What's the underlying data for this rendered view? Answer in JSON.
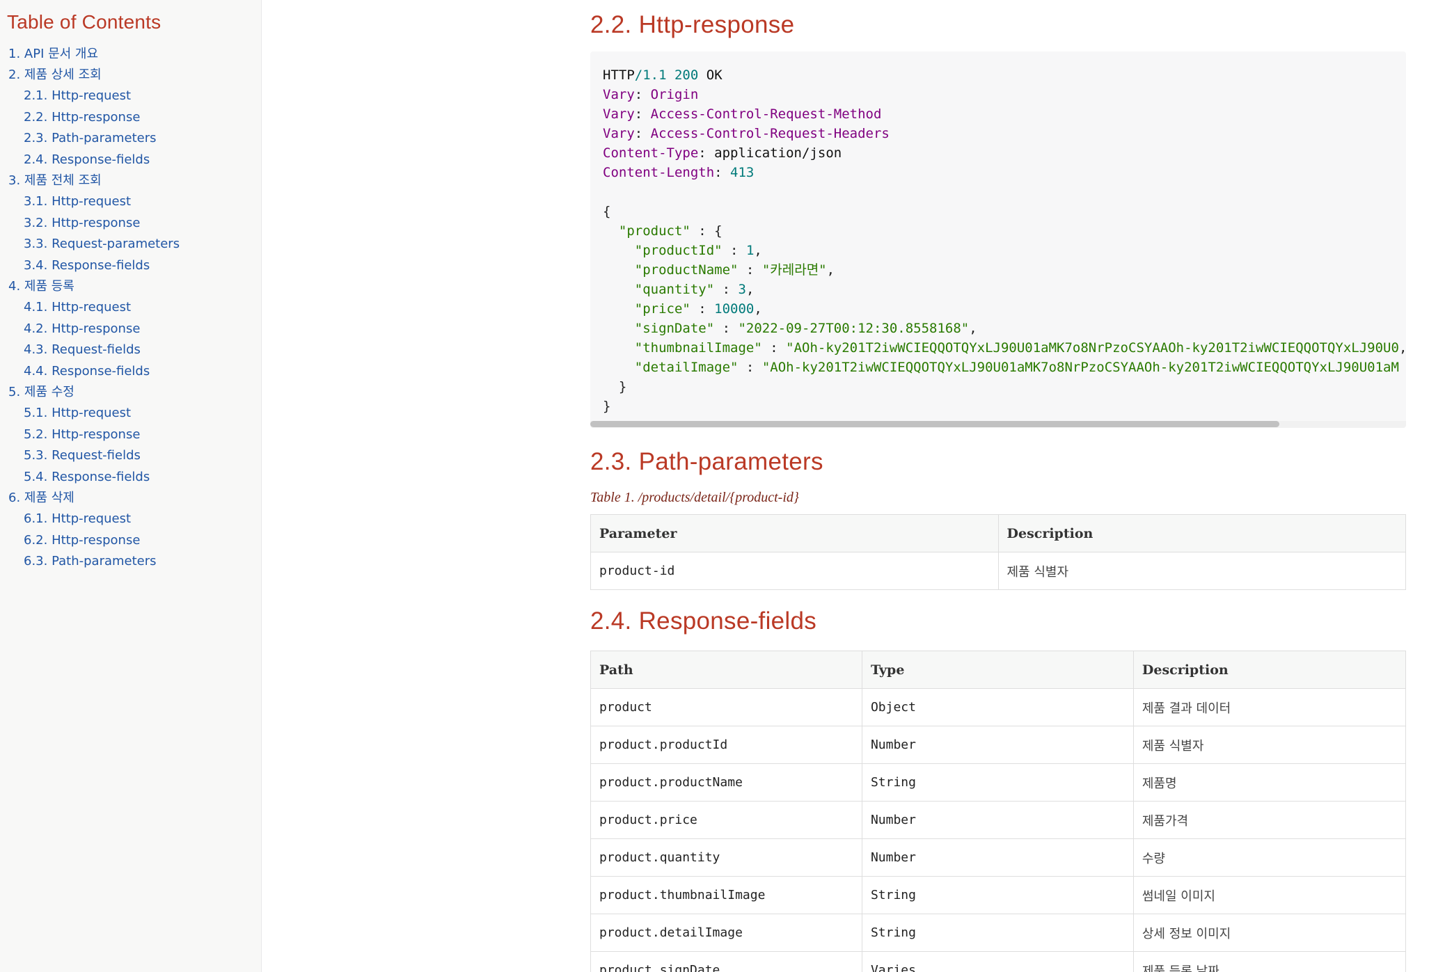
{
  "toc": {
    "title": "Table of Contents",
    "items": [
      {
        "label": "1. API 문서 개요",
        "level": 1
      },
      {
        "label": "2. 제품 상세 조회",
        "level": 1
      },
      {
        "label": "2.1. Http-request",
        "level": 2
      },
      {
        "label": "2.2. Http-response",
        "level": 2
      },
      {
        "label": "2.3. Path-parameters",
        "level": 2
      },
      {
        "label": "2.4. Response-fields",
        "level": 2
      },
      {
        "label": "3. 제품 전체 조회",
        "level": 1
      },
      {
        "label": "3.1. Http-request",
        "level": 2
      },
      {
        "label": "3.2. Http-response",
        "level": 2
      },
      {
        "label": "3.3. Request-parameters",
        "level": 2
      },
      {
        "label": "3.4. Response-fields",
        "level": 2
      },
      {
        "label": "4. 제품 등록",
        "level": 1
      },
      {
        "label": "4.1. Http-request",
        "level": 2
      },
      {
        "label": "4.2. Http-response",
        "level": 2
      },
      {
        "label": "4.3. Request-fields",
        "level": 2
      },
      {
        "label": "4.4. Response-fields",
        "level": 2
      },
      {
        "label": "5. 제품 수정",
        "level": 1
      },
      {
        "label": "5.1. Http-request",
        "level": 2
      },
      {
        "label": "5.2. Http-response",
        "level": 2
      },
      {
        "label": "5.3. Request-fields",
        "level": 2
      },
      {
        "label": "5.4. Response-fields",
        "level": 2
      },
      {
        "label": "6. 제품 삭제",
        "level": 1
      },
      {
        "label": "6.1. Http-request",
        "level": 2
      },
      {
        "label": "6.2. Http-response",
        "level": 2
      },
      {
        "label": "6.3. Path-parameters",
        "level": 2
      }
    ]
  },
  "sections": {
    "http_response": {
      "title": "2.2. Http-response",
      "status_line": {
        "proto": "HTTP",
        "version": "/1.1",
        "code": "200",
        "reason": "OK"
      },
      "headers": [
        {
          "name": "Vary",
          "value": "Origin"
        },
        {
          "name": "Vary",
          "value": "Access-Control-Request-Method"
        },
        {
          "name": "Vary",
          "value": "Access-Control-Request-Headers"
        },
        {
          "name": "Content-Type",
          "value": "application/json"
        },
        {
          "name": "Content-Length",
          "value": "413"
        }
      ],
      "body": {
        "root_key": "\"product\"",
        "fields": [
          {
            "key": "\"productId\"",
            "value": "1",
            "type": "num"
          },
          {
            "key": "\"productName\"",
            "value": "\"카레라면\"",
            "type": "str"
          },
          {
            "key": "\"quantity\"",
            "value": "3",
            "type": "num"
          },
          {
            "key": "\"price\"",
            "value": "10000",
            "type": "num"
          },
          {
            "key": "\"signDate\"",
            "value": "\"2022-09-27T00:12:30.8558168\"",
            "type": "str"
          },
          {
            "key": "\"thumbnailImage\"",
            "value": "\"AOh-ky201T2iwWCIEQQOTQYxLJ90U01aMK7o8NrPzoCSYAAOh-ky201T2iwWCIEQQOTQYxLJ90U0",
            "type": "str"
          },
          {
            "key": "\"detailImage\"",
            "value": "\"AOh-ky201T2iwWCIEQQOTQYxLJ90U01aMK7o8NrPzoCSYAAOh-ky201T2iwWCIEQQOTQYxLJ90U01aM",
            "type": "str"
          }
        ]
      },
      "horizontal_scroll_position": 0
    },
    "path_parameters": {
      "title": "2.3. Path-parameters",
      "caption": "Table 1. /products/detail/{product-id}",
      "headers": [
        "Parameter",
        "Description"
      ],
      "rows": [
        [
          "product-id",
          "제품 식별자"
        ]
      ]
    },
    "response_fields": {
      "title": "2.4. Response-fields",
      "headers": [
        "Path",
        "Type",
        "Description"
      ],
      "rows": [
        [
          "product",
          "Object",
          "제품 결과 데이터"
        ],
        [
          "product.productId",
          "Number",
          "제품 식별자"
        ],
        [
          "product.productName",
          "String",
          "제품명"
        ],
        [
          "product.price",
          "Number",
          "제품가격"
        ],
        [
          "product.quantity",
          "Number",
          "수량"
        ],
        [
          "product.thumbnailImage",
          "String",
          "썸네일 이미지"
        ],
        [
          "product.detailImage",
          "String",
          "상세 정보 이미지"
        ],
        [
          "product.signDate",
          "Varies",
          "제품 등록 날짜"
        ]
      ]
    }
  },
  "colors": {
    "heading": "#ba3925",
    "link": "#2156a5",
    "sidebar_bg": "#f8f8f7",
    "code_bg": "#f7f7f8",
    "code_key": "#800080",
    "code_number": "#007a7a",
    "code_string": "#2a7a00"
  }
}
